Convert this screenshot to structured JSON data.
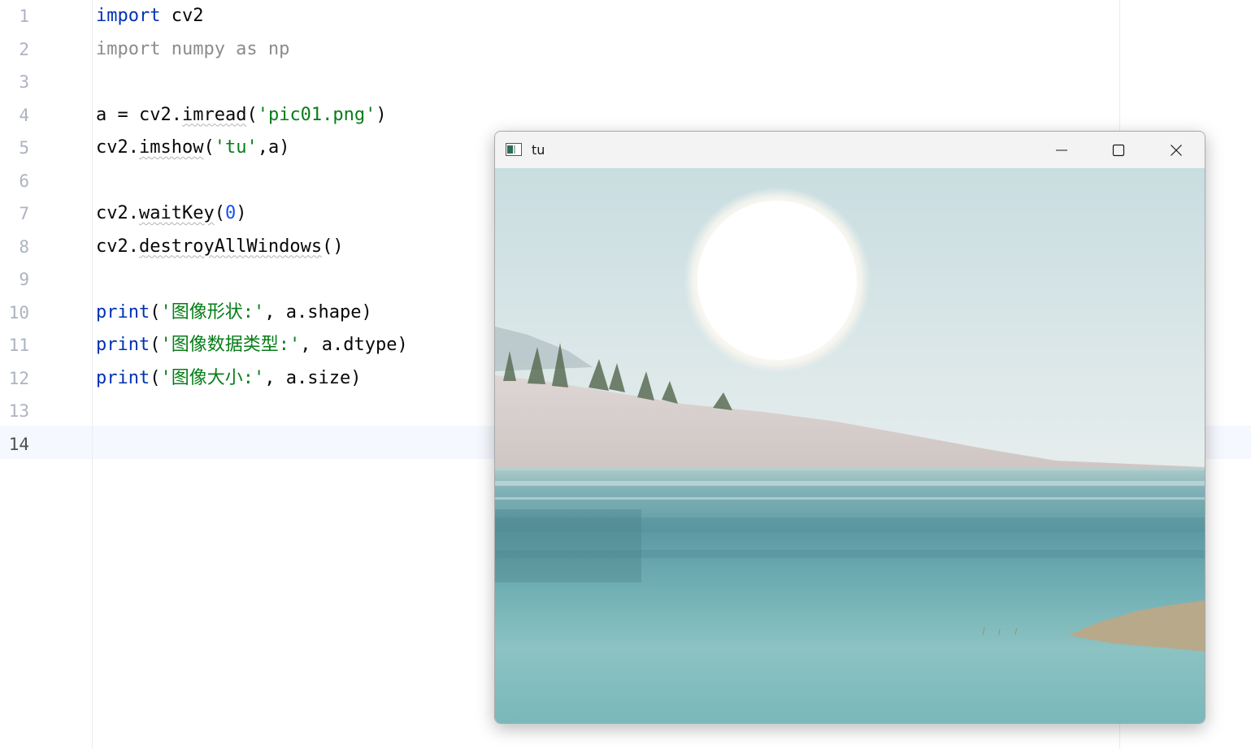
{
  "editor": {
    "lines": [
      {
        "num": "1",
        "parts": [
          {
            "t": "import",
            "c": "kw"
          },
          {
            "t": " cv2",
            "c": ""
          }
        ]
      },
      {
        "num": "2",
        "parts": [
          {
            "t": "import numpy as np",
            "c": "unused"
          }
        ]
      },
      {
        "num": "3",
        "parts": []
      },
      {
        "num": "4",
        "parts": [
          {
            "t": "a = cv2.",
            "c": ""
          },
          {
            "t": "imread",
            "c": "wavy"
          },
          {
            "t": "(",
            "c": ""
          },
          {
            "t": "'pic01.png'",
            "c": "str"
          },
          {
            "t": ")",
            "c": ""
          }
        ]
      },
      {
        "num": "5",
        "parts": [
          {
            "t": "cv2.",
            "c": ""
          },
          {
            "t": "imshow",
            "c": "wavy"
          },
          {
            "t": "(",
            "c": ""
          },
          {
            "t": "'tu'",
            "c": "str"
          },
          {
            "t": ",a)",
            "c": ""
          }
        ]
      },
      {
        "num": "6",
        "parts": []
      },
      {
        "num": "7",
        "parts": [
          {
            "t": "cv2.",
            "c": ""
          },
          {
            "t": "waitKey",
            "c": "wavy"
          },
          {
            "t": "(",
            "c": ""
          },
          {
            "t": "0",
            "c": "num"
          },
          {
            "t": ")",
            "c": ""
          }
        ]
      },
      {
        "num": "8",
        "parts": [
          {
            "t": "cv2.",
            "c": ""
          },
          {
            "t": "destroyAllWindows",
            "c": "wavy"
          },
          {
            "t": "()",
            "c": ""
          }
        ]
      },
      {
        "num": "9",
        "parts": []
      },
      {
        "num": "10",
        "parts": [
          {
            "t": "print",
            "c": "kw"
          },
          {
            "t": "(",
            "c": ""
          },
          {
            "t": "'图像形状:'",
            "c": "str"
          },
          {
            "t": ", a.shape)",
            "c": ""
          }
        ]
      },
      {
        "num": "11",
        "parts": [
          {
            "t": "print",
            "c": "kw"
          },
          {
            "t": "(",
            "c": ""
          },
          {
            "t": "'图像数据类型:'",
            "c": "str"
          },
          {
            "t": ", a.dtype)",
            "c": ""
          }
        ]
      },
      {
        "num": "12",
        "parts": [
          {
            "t": "print",
            "c": "kw"
          },
          {
            "t": "(",
            "c": ""
          },
          {
            "t": "'图像大小:'",
            "c": "str"
          },
          {
            "t": ", a.size)",
            "c": ""
          }
        ]
      },
      {
        "num": "13",
        "parts": []
      },
      {
        "num": "14",
        "parts": []
      }
    ],
    "current_line": "14",
    "colors": {
      "keyword": "#0033b3",
      "string": "#067d17",
      "number": "#1750eb",
      "unused": "#8c8c8c"
    }
  },
  "window": {
    "title": "tu",
    "icon": "app-window-icon",
    "buttons": {
      "minimize": "minimize-icon",
      "maximize": "maximize-icon",
      "close": "close-icon"
    }
  }
}
